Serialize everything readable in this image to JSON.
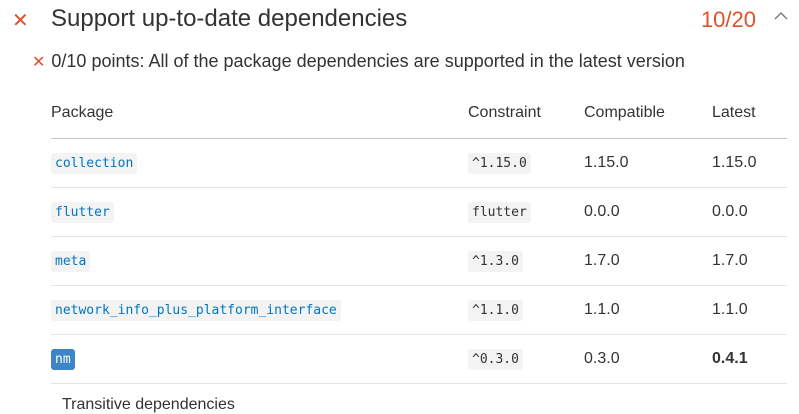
{
  "header": {
    "status_icon": "cross-icon",
    "title": "Support up-to-date dependencies",
    "score": "10/20",
    "expand_icon": "chevron-up-icon"
  },
  "summary": {
    "status_icon": "cross-icon",
    "text": "0/10 points: All of the package dependencies are supported in the latest version"
  },
  "table": {
    "columns": [
      "Package",
      "Constraint",
      "Compatible",
      "Latest"
    ],
    "rows": [
      {
        "package": "collection",
        "constraint": "^1.15.0",
        "compatible": "1.15.0",
        "latest": "1.15.0"
      },
      {
        "package": "flutter",
        "constraint": "flutter",
        "compatible": "0.0.0",
        "latest": "0.0.0"
      },
      {
        "package": "meta",
        "constraint": "^1.3.0",
        "compatible": "1.7.0",
        "latest": "1.7.0"
      },
      {
        "package": "network_info_plus_platform_interface",
        "constraint": "^1.1.0",
        "compatible": "1.1.0",
        "latest": "1.1.0"
      },
      {
        "package": "nm",
        "constraint": "^0.3.0",
        "compatible": "0.3.0",
        "latest": "0.4.1"
      }
    ]
  },
  "footer_text": "Transitive dependencies"
}
